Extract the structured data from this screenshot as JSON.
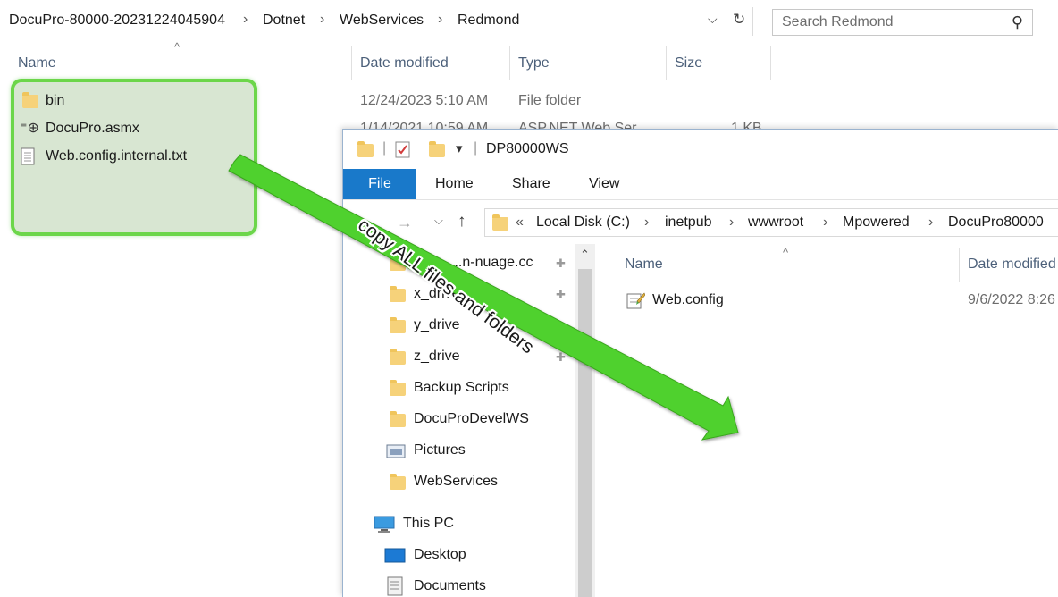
{
  "back_window": {
    "breadcrumb": [
      "DocuPro-80000-20231224045904",
      "Dotnet",
      "WebServices",
      "Redmond"
    ],
    "search_placeholder": "Search Redmond",
    "columns": [
      "Name",
      "Date modified",
      "Type",
      "Size"
    ],
    "files": [
      {
        "name": "bin",
        "date": "12/24/2023 5:10 AM",
        "type": "File folder",
        "size": "",
        "icon": "folder-icon"
      },
      {
        "name": "DocuPro.asmx",
        "date": "1/14/2021 10:59 AM",
        "type": "ASP.NET Web Ser...",
        "size": "1 KB",
        "icon": "globe-icon"
      },
      {
        "name": "Web.config.internal.txt",
        "date": "",
        "type": "",
        "size": "",
        "icon": "text-file-icon"
      }
    ]
  },
  "front_window": {
    "title": "DP80000WS",
    "ribbon_tabs": [
      "File",
      "Home",
      "Share",
      "View"
    ],
    "address": [
      "Local Disk (C:)",
      "inetpub",
      "wwwroot",
      "Mpowered",
      "DocuPro80000"
    ],
    "address_prefix": "«",
    "nav_items": [
      {
        "label": "...n-nuage.cc",
        "icon": "folder-icon",
        "pinned": true
      },
      {
        "label": "x_drive",
        "icon": "folder-icon",
        "pinned": true
      },
      {
        "label": "y_drive",
        "icon": "folder-icon",
        "pinned": false
      },
      {
        "label": "z_drive",
        "icon": "folder-icon",
        "pinned": true
      },
      {
        "label": "Backup Scripts",
        "icon": "folder-icon",
        "pinned": false
      },
      {
        "label": "DocuProDevelWS",
        "icon": "folder-icon",
        "pinned": false
      },
      {
        "label": "Pictures",
        "icon": "pictures-icon",
        "pinned": false
      },
      {
        "label": "WebServices",
        "icon": "folder-icon",
        "pinned": false
      },
      {
        "label": "This PC",
        "icon": "pc-icon",
        "pinned": false
      },
      {
        "label": "Desktop",
        "icon": "desktop-icon",
        "pinned": false
      },
      {
        "label": "Documents",
        "icon": "documents-icon",
        "pinned": false
      }
    ],
    "columns": [
      "Name",
      "Date modified"
    ],
    "files": [
      {
        "name": "Web.config",
        "date": "9/6/2022 8:26",
        "icon": "config-file-icon"
      }
    ]
  },
  "annotation": {
    "text": "copy ALL files and folders",
    "arrow_color": "#4fd12e"
  },
  "colors": {
    "highlight_border": "#6cd64a",
    "highlight_fill": "#d8e6d2",
    "file_tab": "#1979ca",
    "column_header": "#4c607a"
  }
}
